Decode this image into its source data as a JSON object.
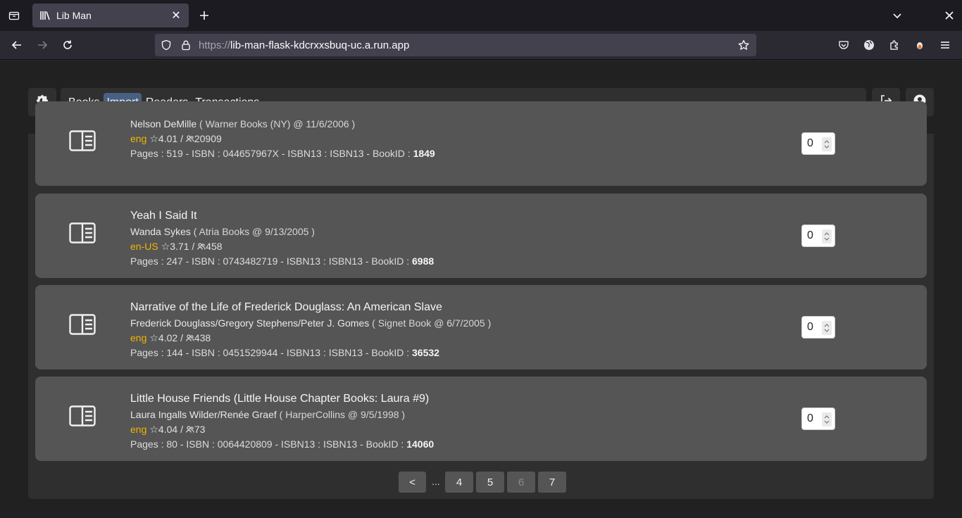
{
  "browser": {
    "tab_title": "Lib Man",
    "url_scheme": "https://",
    "url_host": "lib-man-flask-kdcrxxsbuq-uc.a.run.app"
  },
  "nav": {
    "items": [
      "Books",
      "Import",
      "Readers",
      "Transactions"
    ],
    "active": "Import"
  },
  "books": [
    {
      "title": "",
      "authors": "Nelson DeMille",
      "publisher_date": "( Warner Books (NY) @ 11/6/2006 )",
      "lang": "eng",
      "rating": "4.01",
      "ratings_count": "20909",
      "pages_line": "Pages : 519 - ISBN : 044657967X - ISBN13 : ISBN13 - BookID :",
      "book_id": "1849",
      "qty": "0"
    },
    {
      "title": "Yeah I Said It",
      "authors": "Wanda Sykes",
      "publisher_date": "( Atria Books @ 9/13/2005 )",
      "lang": "en-US",
      "rating": "3.71",
      "ratings_count": "458",
      "pages_line": "Pages : 247 - ISBN : 0743482719 - ISBN13 : ISBN13 - BookID :",
      "book_id": "6988",
      "qty": "0"
    },
    {
      "title": "Narrative of the Life of Frederick Douglass: An American Slave",
      "authors": "Frederick Douglass/Gregory Stephens/Peter J. Gomes",
      "publisher_date": "( Signet Book @ 6/7/2005 )",
      "lang": "eng",
      "rating": "4.02",
      "ratings_count": "438",
      "pages_line": "Pages : 144 - ISBN : 0451529944 - ISBN13 : ISBN13 - BookID :",
      "book_id": "36532",
      "qty": "0"
    },
    {
      "title": "Little House Friends (Little House Chapter Books: Laura #9)",
      "authors": "Laura Ingalls Wilder/Renée Graef",
      "publisher_date": "( HarperCollins @ 9/5/1998 )",
      "lang": "eng",
      "rating": "4.04",
      "ratings_count": "73",
      "pages_line": "Pages : 80 - ISBN : 0064420809 - ISBN13 : ISBN13 - BookID :",
      "book_id": "14060",
      "qty": "0"
    }
  ],
  "rating_sep": "/",
  "pagination": {
    "prev": "<",
    "ellipsis": "...",
    "pages": [
      "4",
      "5",
      "6",
      "7"
    ],
    "current": "6"
  }
}
